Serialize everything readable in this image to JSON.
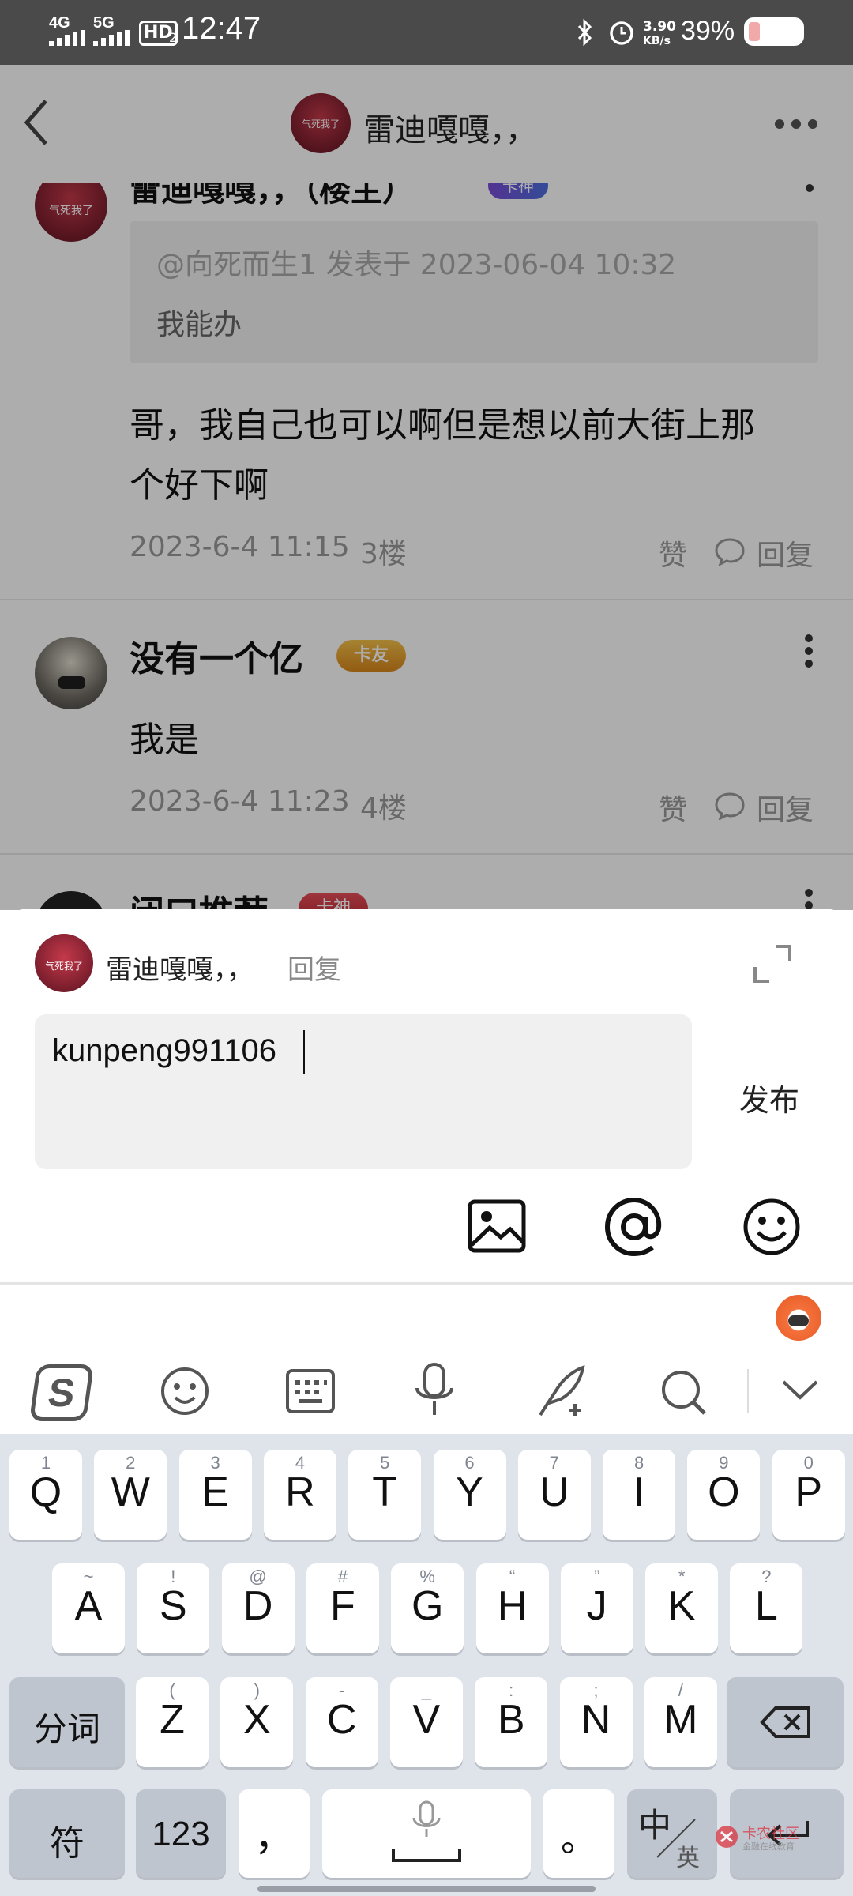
{
  "status_bar": {
    "signal1": "4G",
    "signal2": "5G",
    "hd": "HD",
    "hd_sub": "2",
    "time": "12:47",
    "net_speed_value": "3.90",
    "net_speed_unit": "KB/s",
    "battery": "39%"
  },
  "header": {
    "title": "雷迪嘎嘎，，",
    "avatar_text": "气死我了"
  },
  "posts": [
    {
      "author": "雷迪嘎嘎，，（楼主）",
      "badge": "卡神",
      "avatar_text": "气死我了",
      "quote_meta": "@向死而生1 发表于 2023-06-04 10:32",
      "quote_text": "我能办",
      "text_line1": "哥，我自己也可以啊但是想以前大街上那",
      "text_line2": "个好下啊",
      "time": "2023-6-4 11:15",
      "floor": "3楼",
      "like": "赞",
      "reply": "回复"
    },
    {
      "author": "没有一个亿",
      "badge": "卡友",
      "text": "我是",
      "time": "2023-6-4 11:23",
      "floor": "4楼",
      "like": "赞",
      "reply": "回复"
    },
    {
      "author": "闭口推荐",
      "badge": "卡神"
    }
  ],
  "reply_panel": {
    "target_name": "雷迪嘎嘎，，",
    "reply_label": "回复",
    "input_value": "kunpeng991106",
    "publish_label": "发布",
    "avatar_text": "气死我了"
  },
  "keyboard": {
    "row1": [
      {
        "k": "Q",
        "s": "1"
      },
      {
        "k": "W",
        "s": "2"
      },
      {
        "k": "E",
        "s": "3"
      },
      {
        "k": "R",
        "s": "4"
      },
      {
        "k": "T",
        "s": "5"
      },
      {
        "k": "Y",
        "s": "6"
      },
      {
        "k": "U",
        "s": "7"
      },
      {
        "k": "I",
        "s": "8"
      },
      {
        "k": "O",
        "s": "9"
      },
      {
        "k": "P",
        "s": "0"
      }
    ],
    "row2": [
      {
        "k": "A",
        "s": "~"
      },
      {
        "k": "S",
        "s": "!"
      },
      {
        "k": "D",
        "s": "@"
      },
      {
        "k": "F",
        "s": "#"
      },
      {
        "k": "G",
        "s": "%"
      },
      {
        "k": "H",
        "s": "“"
      },
      {
        "k": "J",
        "s": "”"
      },
      {
        "k": "K",
        "s": "*"
      },
      {
        "k": "L",
        "s": "?"
      }
    ],
    "row3": [
      {
        "k": "Z",
        "s": "("
      },
      {
        "k": "X",
        "s": ")"
      },
      {
        "k": "C",
        "s": "-"
      },
      {
        "k": "V",
        "s": "_"
      },
      {
        "k": "B",
        "s": ":"
      },
      {
        "k": "N",
        "s": ";"
      },
      {
        "k": "M",
        "s": "/"
      }
    ],
    "fenci": "分词",
    "fu": "符",
    "num": "123",
    "comma": "，",
    "period": "。",
    "zh": "中",
    "en": "英"
  },
  "watermark": {
    "line1": "卡农社区",
    "line2": "金融在线教育"
  }
}
